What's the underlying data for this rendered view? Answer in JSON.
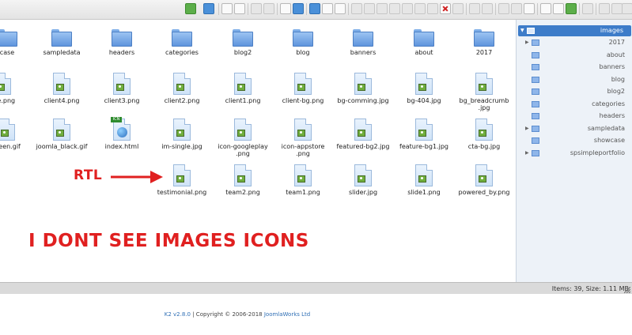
{
  "toolbar": {
    "buttons": [
      "fullscreen-icon",
      "help-icon",
      "view-list-icon",
      "view-icons-icon",
      "upload-icon",
      "info-icon",
      "select-icon",
      "open-icon",
      "new-folder-icon",
      "new-file-icon",
      "extract-icon",
      "archive-icon",
      "back-icon",
      "forward-icon",
      "up-icon",
      "reload-icon",
      "home-icon",
      "copy-icon",
      "cut-icon",
      "paste-icon",
      "delete-icon",
      "duplicate-icon",
      "rename-icon",
      "edit-icon",
      "resize-icon",
      "undo-icon",
      "redo-icon",
      "search-icon",
      "preferences-icon",
      "sort-icon"
    ]
  },
  "files": {
    "row1": [
      "showcase",
      "sampledata",
      "headers",
      "categories",
      "blog2",
      "blog",
      "banners",
      "about",
      "2017"
    ],
    "row2": [
      "...ible.png",
      "client4.png",
      "client3.png",
      "client2.png",
      "client1.png",
      "client-bg.png",
      "bg-comming.jpg",
      "bg-404.jpg",
      "bg_breadcrumb\n.jpg"
    ],
    "row3": [
      "...green.gif",
      "joomla_black.gif",
      "index.html",
      "im-single.jpg",
      "icon-googleplay\n.png",
      "icon-appstore\n.png",
      "featured-bg2.jpg",
      "feature-bg1.jpg",
      "cta-bg.jpg"
    ],
    "row4": [
      "testimonial.png",
      "team2.png",
      "team1.png",
      "slider.jpg",
      "slide1.png",
      "powered_by.png"
    ],
    "row1_display": [
      "case",
      "sampledata",
      "headers",
      "categories",
      "blog2",
      "blog",
      "banners",
      "about",
      "2017"
    ],
    "row2_display": [
      "ible.png",
      "client4.png",
      "client3.png",
      "client2.png",
      "client1.png",
      "client-bg.png",
      "bg-comming.jpg",
      "bg-404.jpg",
      "bg_breadcrumb"
    ],
    "row2_extra": ".jpg",
    "row3_display": [
      "green.gif",
      "joomla_black.gif",
      "index.html",
      "im-single.jpg",
      "icon-googleplay",
      "icon-appstore",
      "featured-bg2.jpg",
      "feature-bg1.jpg",
      "cta-bg.jpg"
    ],
    "row3_extra_googleplay": ".png",
    "row3_extra_appstore": ".png",
    "html_badge": "ICN"
  },
  "annotations": {
    "rtl": "RTL",
    "main": "I DONT SEE IMAGES ICONS",
    "color": "#e02020"
  },
  "sidebar": {
    "root": "images",
    "items": [
      "2017",
      "about",
      "banners",
      "blog",
      "blog2",
      "categories",
      "headers",
      "sampledata",
      "showcase",
      "spsimpleportfolio"
    ]
  },
  "status": {
    "text": "Items: 39, Size: 1.11 MB"
  },
  "footer": {
    "k2": "K2 v2.8.0",
    "copyright": " | Copyright © 2006-2018 ",
    "company": "JoomlaWorks Ltd"
  }
}
